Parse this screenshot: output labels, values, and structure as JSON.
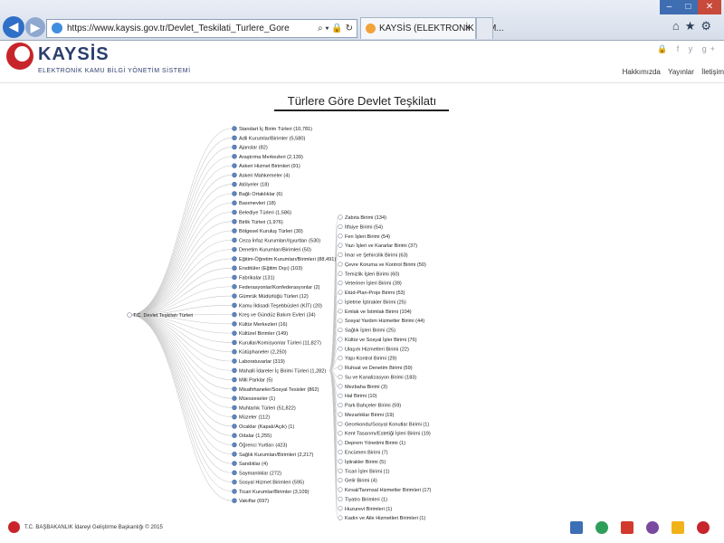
{
  "browser": {
    "url": "https://www.kaysis.gov.tr/Devlet_Teskilati_Turlere_Gore",
    "tab_title": "KAYSİS (ELEKTRONİK KAM...",
    "tab_close": "×",
    "addr_controls": "⌕ ▾ 🔒 ↻"
  },
  "window": {
    "min": "–",
    "max": "□",
    "close": "✕"
  },
  "header": {
    "brand": "KAYSİS",
    "subtitle": "ELEKTRONİK  KAMU BİLGİ YÖNETİM SİSTEMİ",
    "nav": [
      "Hakkımızda",
      "Yayınlar",
      "İletişim"
    ],
    "social": "🔒 f y g+"
  },
  "page": {
    "title": "Türlere Göre Devlet Teşkilatı"
  },
  "tree": {
    "root": "T.C. Devlet Teşkilatı Türleri",
    "col1": [
      "Standart İç Birim Türleri (10,781)",
      "Adli Kurumlar/Birimler (5,580)",
      "Ajanslar (82)",
      "Araştırma Merkezleri (2,139)",
      "Askeri Hizmet Birimleri (91)",
      "Askeri Mahkemeler (4)",
      "Atölyeler (18)",
      "Bağlı Ortaklıklar (6)",
      "Basımevleri (18)",
      "Belediye Türleri (1,586)",
      "Birlik Türleri (1,976)",
      "Bölgesel Kuruluş Türleri (30)",
      "Ceza İnfaz Kurumları/Işyurtları (530)",
      "Denetim Kurumları/Birimleri (50)",
      "Eğitim-Öğretim Kurumları/Birimleri (88,491)",
      "Enstitüler (Eğitim Dışı) (103)",
      "Fabrikalar (131)",
      "Federasyonlar/Konfederasyonlar (2)",
      "Gümrük Müdürlüğü Türleri (12)",
      "Kamu İktisadi Teşebbüsleri (KİT) (20)",
      "Kreş ve Gündüz Bakım Evleri (34)",
      "Kültür Merkezleri (16)",
      "Kültürel Birimler (149)",
      "Kurullar/Komisyonlar Türleri (11,827)",
      "Kütüphaneler (2,250)",
      "Laboratuvarlar (319)",
      "Mahalli İdareler İç Birimi Türleri (1,282)",
      "Milli Parklar (5)",
      "Misafirhaneler/Sosyal Tesisler (862)",
      "Müesseseler (1)",
      "Muhtarlık Türleri (51,822)",
      "Müzeler (112)",
      "Ocaklar (Kapalı/Açık) (1)",
      "Odalar (1,255)",
      "Öğrenci Yurtları (423)",
      "Sağlık Kurumları/Birimleri (2,217)",
      "Sandıklar (4)",
      "Saymanlıklar (272)",
      "Sosyal Hizmet Birimleri (595)",
      "Ticari Kurumlar/Birimler (3,109)",
      "Vakıflar (697)"
    ],
    "col2": [
      "Zabıta Birimi (134)",
      "İtfaiye Birimi (54)",
      "Fen İşleri Birimi (54)",
      "Yazı İşleri ve Kararlar Birimi (37)",
      "İmar ve Şehircilik Birimi (63)",
      "Çevre Koruma ve Kontrol Birimi (50)",
      "Temizlik İşleri Birimi (60)",
      "Veteriner İşleri Birimi (39)",
      "Etüd-Plan-Proje Birimi (53)",
      "İşletme İştirakler Birimi (25)",
      "Emlak ve İstimlak Birimi (104)",
      "Sosyal Yardım Hizmetler Birimi (44)",
      "Sağlık İşleri Birimi (25)",
      "Kültür ve Sosyal İşler Birimi (76)",
      "Ulaşım Hizmetleri Birimi (22)",
      "Yapı Kontrol Birimi (29)",
      "Ruhsat ve Denetim Birimi (59)",
      "Su ve Kanalizasyon Birimi (183)",
      "Mezbaha Birimi (3)",
      "Hal Birimi (10)",
      "Park Bahçeler Birimi (59)",
      "Mezarlıklar Birimi (19)",
      "Gecekondu/Sosyal Konutlar Birimi (1)",
      "Kent Tasarımı/Estetiği İşleri Birimi (19)",
      "Deprem Yönetimi Birimi (1)",
      "Encümen Birimi (7)",
      "İştirakler Birimi (5)",
      "Ticari İşler Birimi (1)",
      "Gelir Birimi (4)",
      "Kırsal/Tarımsal Hizmetler Birimleri (17)",
      "Tiyatro Birimleri (1)",
      "Huzurevi Birimleri (1)",
      "Kadın ve Aile Hizmetleri Birimleri (1)"
    ]
  },
  "footer": {
    "text": "T.C. BAŞBAKANLIK İdareyi Geliştirme Başkanlığı © 2015",
    "icon_colors": [
      "#3d6fb6",
      "#2f9e5a",
      "#d23a2e",
      "#7a4aa0",
      "#f2b21a",
      "#c7252b"
    ]
  }
}
